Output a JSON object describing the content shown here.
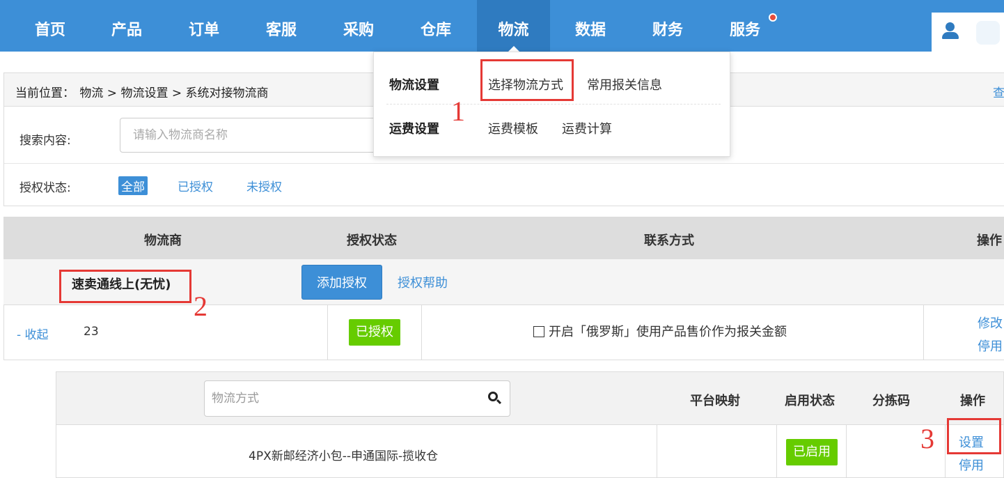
{
  "nav": {
    "items": [
      {
        "label": "首页"
      },
      {
        "label": "产品"
      },
      {
        "label": "订单"
      },
      {
        "label": "客服"
      },
      {
        "label": "采购"
      },
      {
        "label": "仓库"
      },
      {
        "label": "物流"
      },
      {
        "label": "数据"
      },
      {
        "label": "财务"
      },
      {
        "label": "服务"
      }
    ],
    "active": "物流",
    "bar_color": "#3d8fd7",
    "active_color": "#2f7bc0",
    "notification_dot_color": "#e74c3c",
    "user_icon": "user-icon"
  },
  "breadcrumb": {
    "prefix": "当前位置：",
    "path": "物流 > 物流设置 > 系统对接物流商",
    "right_text": "查"
  },
  "filters": {
    "search_label": "搜索内容:",
    "search_placeholder": "请输入物流商名称",
    "auth_label": "授权状态:",
    "auth_options": [
      "全部",
      "已授权",
      "未授权"
    ],
    "auth_selected": "全部"
  },
  "dropdown": {
    "groups": [
      {
        "title": "物流设置",
        "links": [
          "选择物流方式",
          "常用报关信息"
        ]
      },
      {
        "title": "运费设置",
        "links": [
          "运费模板",
          "运费计算"
        ]
      }
    ]
  },
  "table": {
    "headers": [
      "物流商",
      "授权状态",
      "联系方式",
      "操作"
    ],
    "vendor": {
      "name": "速卖通线上(无忧)",
      "add_button": "添加授权",
      "help_link": "授权帮助"
    },
    "row": {
      "collapse": "- 收起",
      "count": "23",
      "status": "已授权",
      "checkbox_label": "开启「俄罗斯」使用产品售价作为报关金额",
      "actions": [
        "修改",
        "停用"
      ]
    }
  },
  "sub_table": {
    "search_placeholder": "物流方式",
    "search_icon": "search-icon",
    "headers": [
      "平台映射",
      "启用状态",
      "分拣码",
      "操作"
    ],
    "row": {
      "method": "4PX新邮经济小包--申通国际-揽收仓",
      "status": "已启用",
      "actions": [
        "设置",
        "停用"
      ]
    }
  },
  "annotations": {
    "numbers": [
      "1",
      "2",
      "3"
    ],
    "color": "#e53935"
  },
  "colors": {
    "link": "#3d8fd7",
    "badge_green": "#66cc00"
  }
}
